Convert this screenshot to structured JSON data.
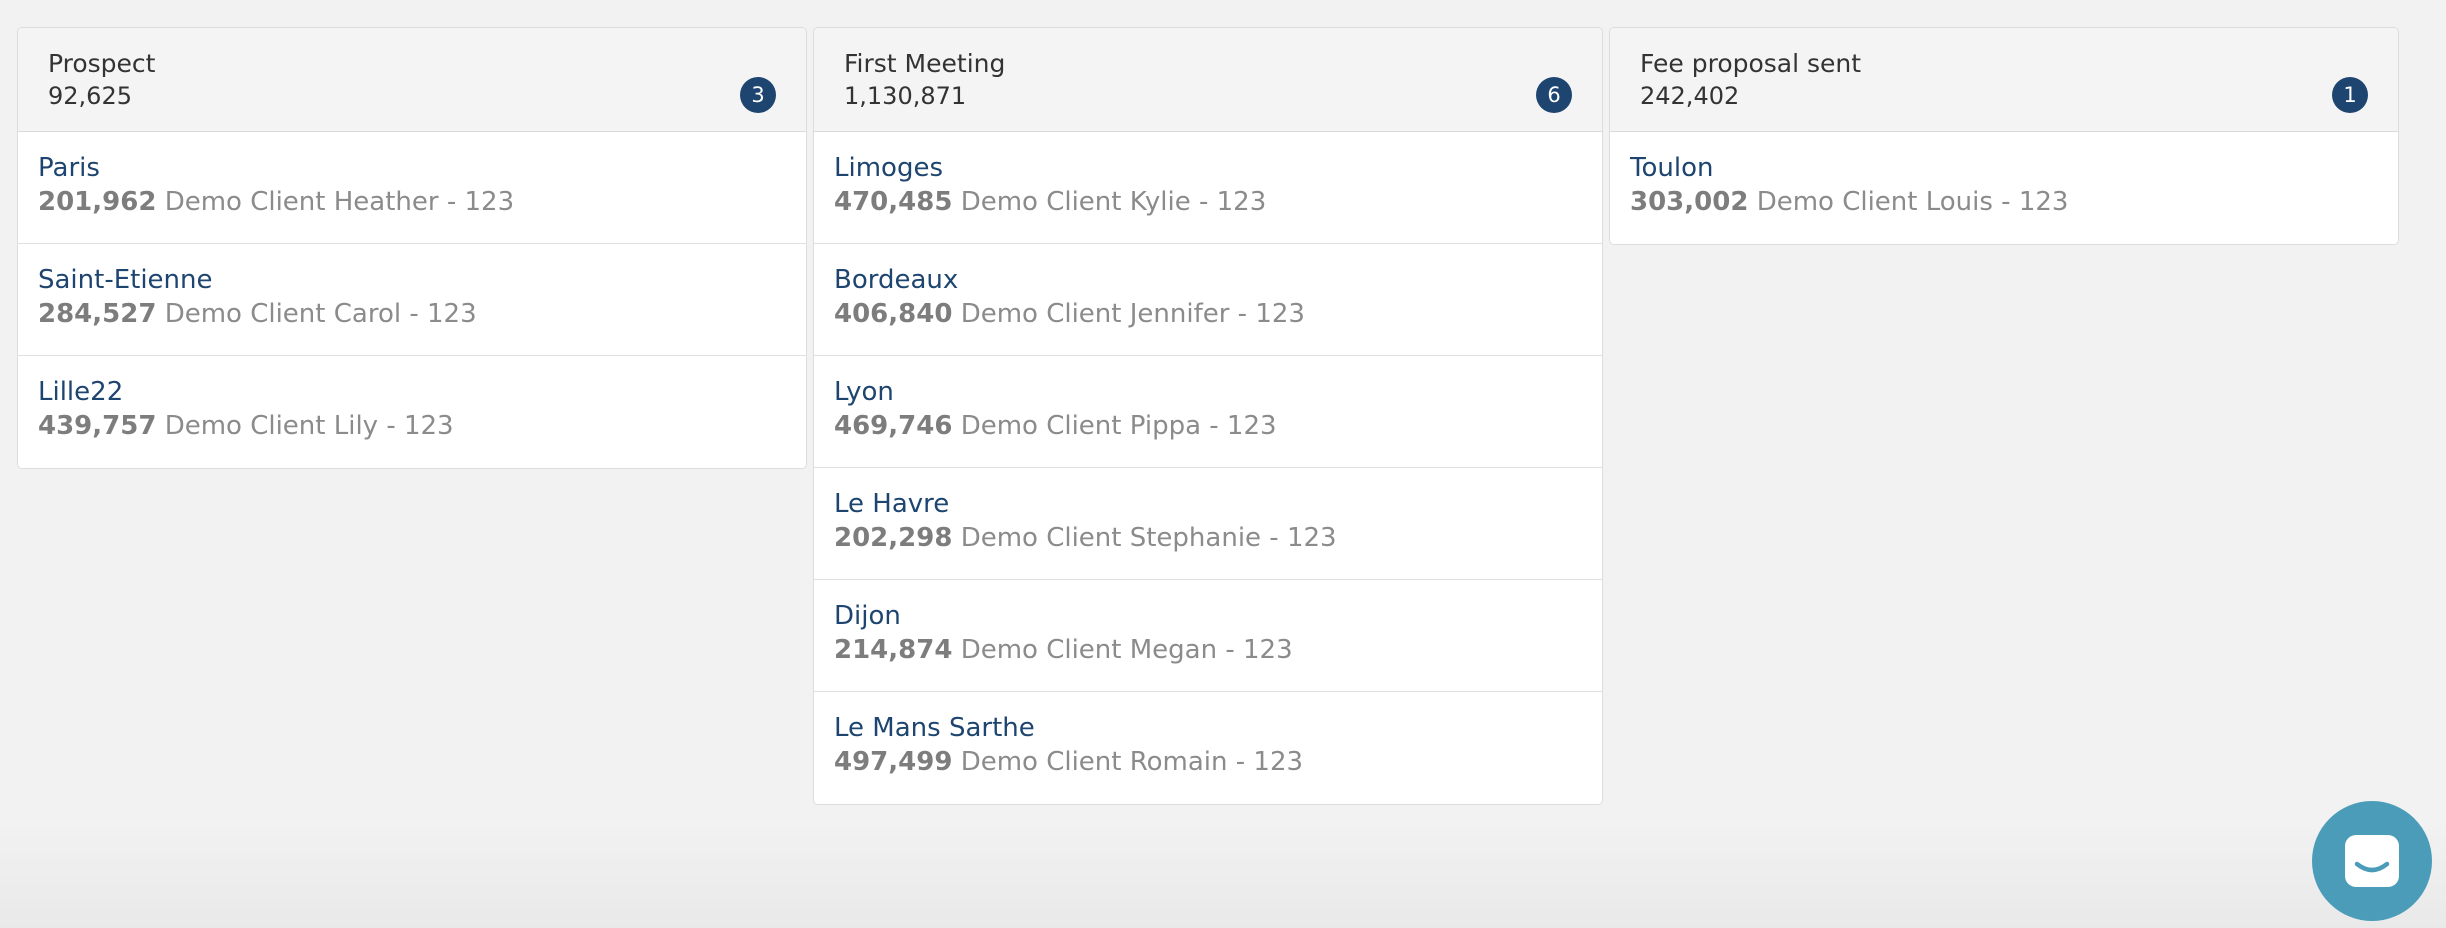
{
  "columns": [
    {
      "title": "Prospect",
      "total": "92,625",
      "count": "3",
      "cards": [
        {
          "city": "Paris",
          "amount": "201,962",
          "client": "Demo Client Heather - 123"
        },
        {
          "city": "Saint-Etienne",
          "amount": "284,527",
          "client": "Demo Client Carol - 123"
        },
        {
          "city": "Lille22",
          "amount": "439,757",
          "client": "Demo Client Lily - 123"
        }
      ]
    },
    {
      "title": "First Meeting",
      "total": "1,130,871",
      "count": "6",
      "cards": [
        {
          "city": "Limoges",
          "amount": "470,485",
          "client": "Demo Client Kylie - 123"
        },
        {
          "city": "Bordeaux",
          "amount": "406,840",
          "client": "Demo Client Jennifer - 123"
        },
        {
          "city": "Lyon",
          "amount": "469,746",
          "client": "Demo Client Pippa - 123"
        },
        {
          "city": "Le Havre",
          "amount": "202,298",
          "client": "Demo Client Stephanie - 123"
        },
        {
          "city": "Dijon",
          "amount": "214,874",
          "client": "Demo Client Megan - 123"
        },
        {
          "city": "Le Mans Sarthe",
          "amount": "497,499",
          "client": "Demo Client Romain - 123"
        }
      ]
    },
    {
      "title": "Fee proposal sent",
      "total": "242,402",
      "count": "1",
      "cards": [
        {
          "city": "Toulon",
          "amount": "303,002",
          "client": "Demo Client Louis - 123"
        }
      ]
    }
  ],
  "chat": {
    "icon": "chat-icon",
    "color": "#4b9cb8"
  },
  "colors": {
    "badge": "#1e4570",
    "card_title": "#1e4570",
    "meta": "#8b8b8b"
  }
}
